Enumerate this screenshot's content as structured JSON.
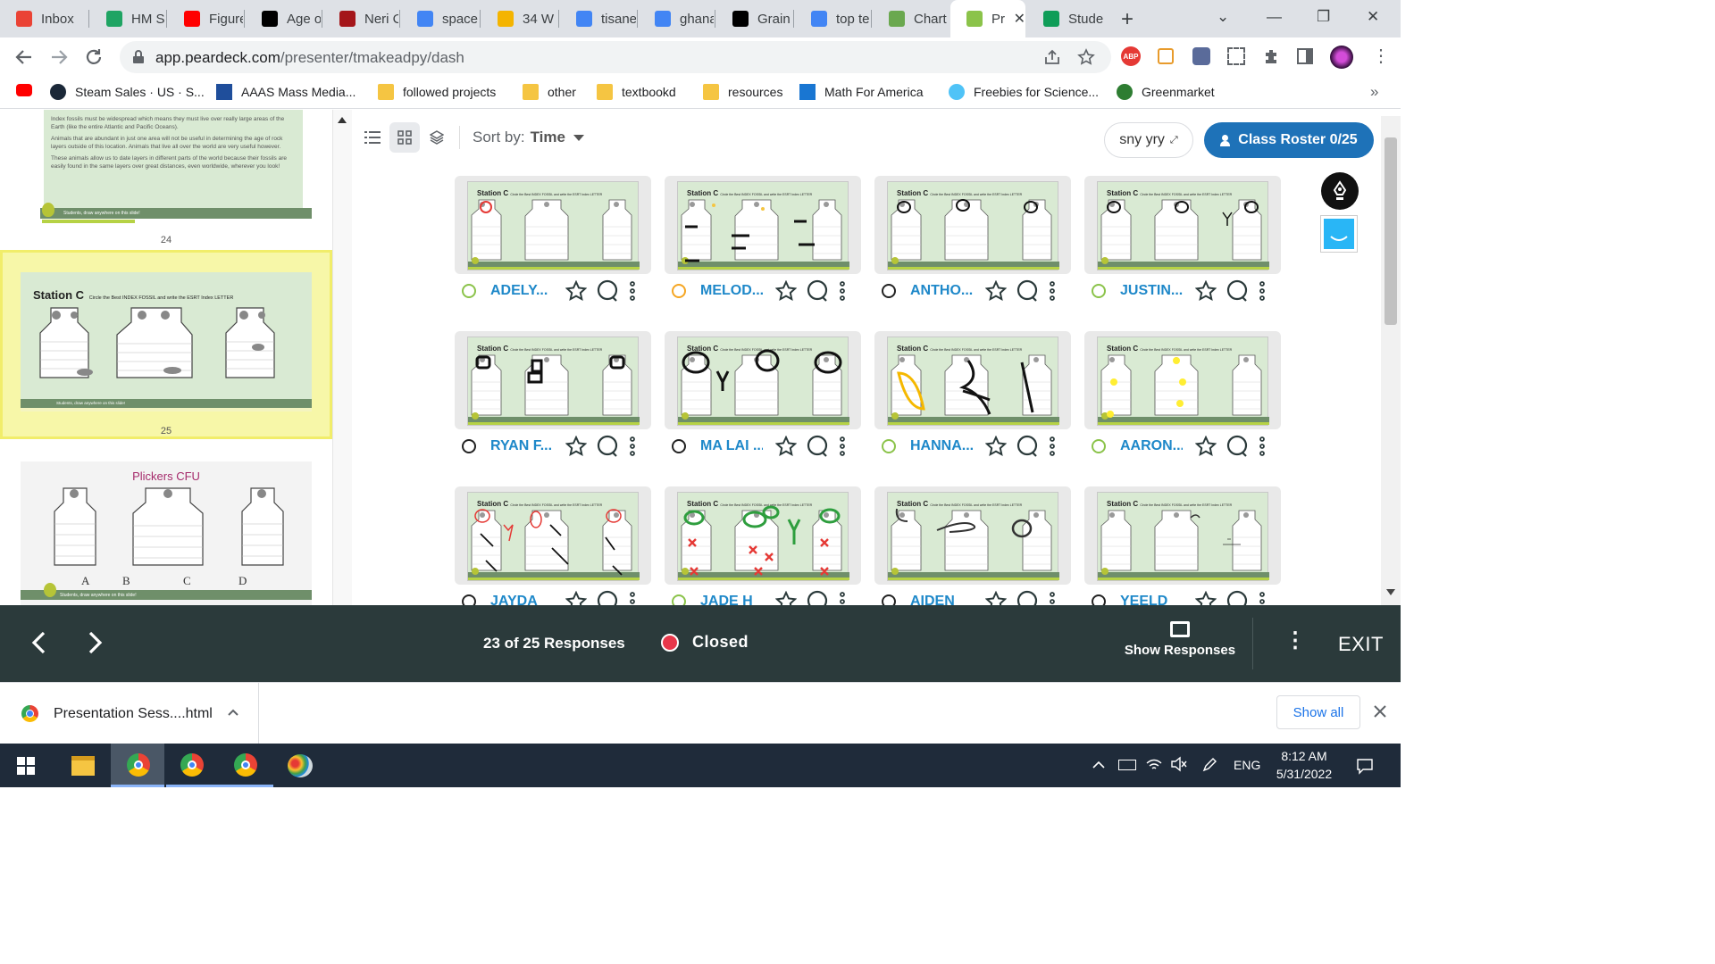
{
  "tabs": [
    {
      "title": "Inbox",
      "icon": "gmail-icon",
      "color": "#ea4335"
    },
    {
      "title": "HM Sp",
      "icon": "drive-icon",
      "color": "#1fa463"
    },
    {
      "title": "Figure",
      "icon": "youtube-icon",
      "color": "#ff0000"
    },
    {
      "title": "Age o",
      "icon": "j-icon",
      "color": "#000000"
    },
    {
      "title": "Neri C",
      "icon": "bars-icon",
      "color": "#a4161a"
    },
    {
      "title": "space",
      "icon": "chrome-search-icon",
      "color": "#4285f4"
    },
    {
      "title": "34 W",
      "icon": "slides-icon",
      "color": "#f4b400"
    },
    {
      "title": "tisane",
      "icon": "google-icon",
      "color": "#4285f4"
    },
    {
      "title": "ghana",
      "icon": "google-icon",
      "color": "#4285f4"
    },
    {
      "title": "Grain",
      "icon": "wikipedia-icon",
      "color": "#000000"
    },
    {
      "title": "top te",
      "icon": "google-icon",
      "color": "#4285f4"
    },
    {
      "title": "Chart",
      "icon": "chart-site-icon",
      "color": "#6aa84f"
    },
    {
      "title": "Pr",
      "icon": "peardeck-icon",
      "color": "#8bc34a",
      "active": true
    },
    {
      "title": "Stude",
      "icon": "plus-green-icon",
      "color": "#0f9d58"
    }
  ],
  "browser": {
    "url_host": "app.peardeck.com",
    "url_path": "/presenter/tmakeadpy/dash"
  },
  "bookmarks": [
    {
      "label": "",
      "icon": "youtube-icon"
    },
    {
      "label": "Steam Sales · US · S...",
      "icon": "steam-icon"
    },
    {
      "label": "AAAS Mass Media...",
      "icon": "aaas-icon"
    },
    {
      "label": "followed projects",
      "icon": "folder-icon"
    },
    {
      "label": "other",
      "icon": "folder-icon"
    },
    {
      "label": "textbookd",
      "icon": "folder-icon"
    },
    {
      "label": "resources",
      "icon": "folder-icon"
    },
    {
      "label": "Math For America",
      "icon": "mfa-icon"
    },
    {
      "label": "Freebies for Science...",
      "icon": "leaf-icon"
    },
    {
      "label": "Greenmarket",
      "icon": "greenmarket-icon"
    }
  ],
  "sidebar": {
    "slide24": {
      "paragraphs": [
        "Index fossils must be widespread which means they must live over really large areas of the Earth (like the entire Atlantic and Pacific Oceans).",
        "Animals that are abundant in just one area will not be useful in determining the age of rock layers outside of this location.  Animals that live all over the world are very useful however.",
        "These animals allow us to date layers in different parts of the world because their fossils are easily found in the same layers over great distances, even worldwide, wherever you look!"
      ],
      "footer": "Students, draw anywhere on this slide!",
      "number": "24"
    },
    "slide25": {
      "title": "Station C",
      "subtitle": "Circle the Best INDEX FOSSIL and write the ESRT Index LETTER",
      "footer": "Students, draw anywhere on this slide!",
      "number": "25"
    },
    "slide26": {
      "title": "Plickers CFU",
      "letters": [
        "A",
        "B",
        "C",
        "D"
      ],
      "footer": "Students, draw anywhere on this slide!"
    }
  },
  "toolbar": {
    "sort_label": "Sort by:",
    "sort_value": "Time",
    "code_label": "sny yry",
    "roster_label": "Class Roster 0/25"
  },
  "responses": [
    {
      "name": "ADELY...",
      "face": "#8bc34a"
    },
    {
      "name": "MELOD...",
      "face": "#f5a623"
    },
    {
      "name": "ANTHO...",
      "face": "#222222"
    },
    {
      "name": "JUSTIN...",
      "face": "#8bc34a"
    },
    {
      "name": "RYAN F...",
      "face": "#222222"
    },
    {
      "name": "MA LAI ...",
      "face": "#222222"
    },
    {
      "name": "HANNA...",
      "face": "#8bc34a"
    },
    {
      "name": "AARON...",
      "face": "#8bc34a"
    },
    {
      "name": "JAYDA",
      "face": "#222222"
    },
    {
      "name": "JADE H",
      "face": "#8bc34a"
    },
    {
      "name": "AIDEN",
      "face": "#222222"
    },
    {
      "name": "YEELD",
      "face": "#222222"
    }
  ],
  "card_title": "Station C",
  "card_subtitle": "Circle the Best INDEX FOSSIL and write the ESRT Index LETTER",
  "bottom": {
    "responses_text": "23 of 25 Responses",
    "status_text": "Closed",
    "show_responses": "Show Responses",
    "exit": "EXIT"
  },
  "download": {
    "file": "Presentation Sess....html",
    "show_all": "Show all"
  },
  "taskbar": {
    "lang": "ENG",
    "time": "8:12 AM",
    "date": "5/31/2022"
  }
}
